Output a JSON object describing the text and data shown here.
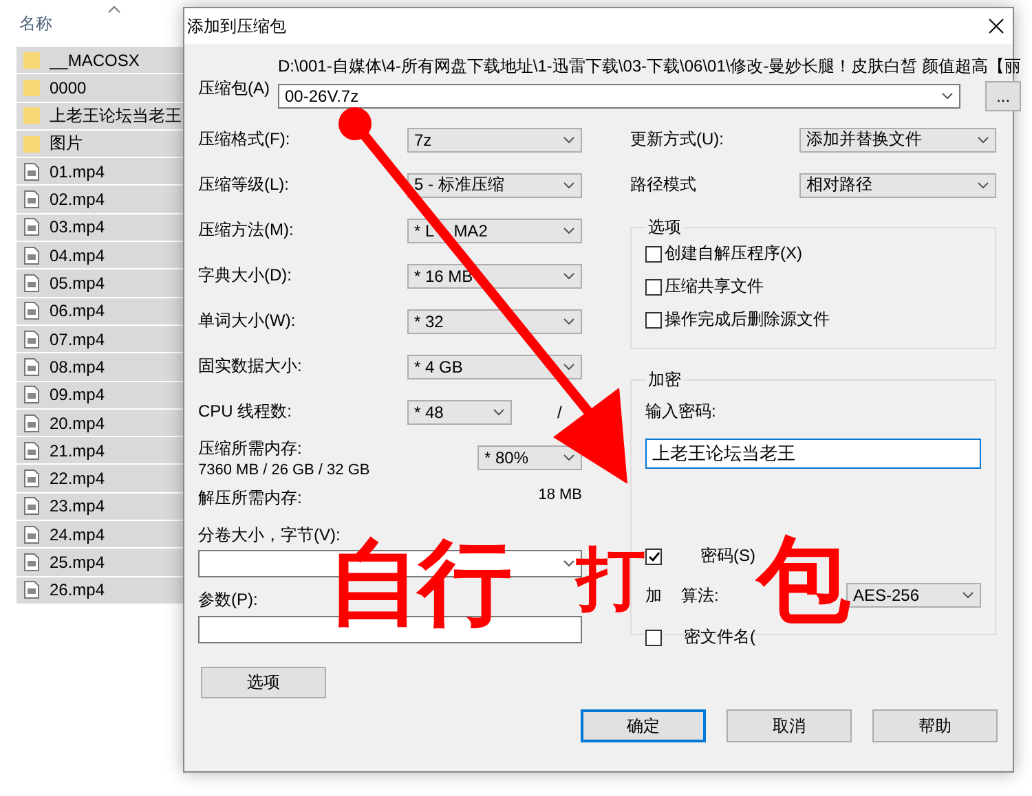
{
  "explorer": {
    "column_header": "名称",
    "items": [
      {
        "kind": "folder",
        "name": "__MACOSX",
        "selected": true
      },
      {
        "kind": "folder",
        "name": "0000",
        "selected": true
      },
      {
        "kind": "folder",
        "name": "上老王论坛当老王",
        "selected": true
      },
      {
        "kind": "folder",
        "name": "图片",
        "selected": true
      },
      {
        "kind": "file",
        "name": "01.mp4",
        "selected": true
      },
      {
        "kind": "file",
        "name": "02.mp4",
        "selected": true
      },
      {
        "kind": "file",
        "name": "03.mp4",
        "selected": true
      },
      {
        "kind": "file",
        "name": "04.mp4",
        "selected": true
      },
      {
        "kind": "file",
        "name": "05.mp4",
        "selected": true
      },
      {
        "kind": "file",
        "name": "06.mp4",
        "selected": true
      },
      {
        "kind": "file",
        "name": "07.mp4",
        "selected": true
      },
      {
        "kind": "file",
        "name": "08.mp4",
        "selected": true
      },
      {
        "kind": "file",
        "name": "09.mp4",
        "selected": true
      },
      {
        "kind": "file",
        "name": "20.mp4",
        "selected": true
      },
      {
        "kind": "file",
        "name": "21.mp4",
        "selected": true
      },
      {
        "kind": "file",
        "name": "22.mp4",
        "selected": true
      },
      {
        "kind": "file",
        "name": "23.mp4",
        "selected": true
      },
      {
        "kind": "file",
        "name": "24.mp4",
        "selected": true
      },
      {
        "kind": "file",
        "name": "25.mp4",
        "selected": true
      },
      {
        "kind": "file",
        "name": "26.mp4",
        "selected": true
      }
    ]
  },
  "dialog": {
    "title": "添加到压缩包",
    "archive": {
      "label": "压缩包(A)",
      "path": "D:\\001-自媒体\\4-所有网盘下载地址\\1-迅雷下载\\03-下载\\06\\01\\修改-曼妙长腿！皮肤白皙 颜值超高【丽",
      "value": "00-26V.7z",
      "browse": "..."
    },
    "left_options": [
      {
        "label": "压缩格式(F):",
        "value": "7z"
      },
      {
        "label": "压缩等级(L):",
        "value": "5 - 标准压缩"
      },
      {
        "label": "压缩方法(M):",
        "value_parts": [
          "* L",
          "MA2"
        ]
      },
      {
        "label": "字典大小(D):",
        "value": "* 16 MB"
      },
      {
        "label": "单词大小(W):",
        "value": "* 32"
      },
      {
        "label": "固实数据大小:",
        "value": "* 4 GB"
      },
      {
        "label": "CPU 线程数:",
        "value": "* 48",
        "suffix": "/"
      }
    ],
    "memory": {
      "compress_label": "压缩所需内存:",
      "compress_value": "7360 MB / 26 GB / 32 GB",
      "percent": "* 80%",
      "decompress_label": "解压所需内存:",
      "decompress_value": "18 MB"
    },
    "split": {
      "label": "分卷大小，字节(V):"
    },
    "params": {
      "label": "参数(P):"
    },
    "options_button": "选项",
    "update": {
      "label": "更新方式(U):",
      "value": "添加并替换文件"
    },
    "path_mode": {
      "label": "路径模式",
      "value": "相对路径"
    },
    "options_group": {
      "title": "选项",
      "checkboxes": [
        {
          "label": "创建自解压程序(X)",
          "checked": false
        },
        {
          "label": "压缩共享文件",
          "checked": false
        },
        {
          "label": "操作完成后删除源文件",
          "checked": false
        }
      ]
    },
    "encryption": {
      "title": "加密",
      "password_label": "输入密码:",
      "password": "上老王论坛当老王",
      "show_password": {
        "label": "密码(S)",
        "checked": true
      },
      "method_label_parts": [
        "加",
        "算法:"
      ],
      "method": "AES-256",
      "encrypt_names": {
        "label": "密文件名(",
        "checked": false
      }
    },
    "buttons": [
      {
        "label": "确定",
        "default": true
      },
      {
        "label": "取消",
        "default": false
      },
      {
        "label": "帮助",
        "default": false
      }
    ]
  },
  "annotation": {
    "characters": [
      "自",
      "行",
      "打",
      "包"
    ]
  }
}
